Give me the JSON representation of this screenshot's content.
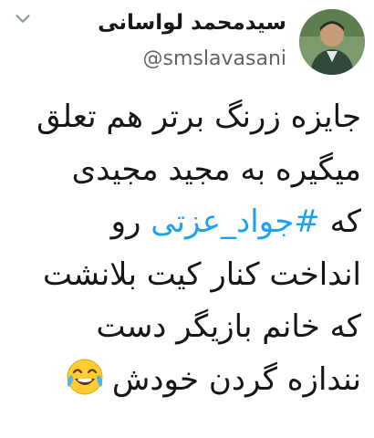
{
  "tweet": {
    "author": {
      "display_name": "سیدمحمد لواسانی",
      "handle": "@smslavasani"
    },
    "body": {
      "line1": "جایزه زرنگ برتر هم تعلق",
      "line2": "میگیره به مجید مجیدی",
      "line3_before": "که ",
      "line3_hashtag": "#جواد_عزتی",
      "line3_after": " رو",
      "line4": "انداخت کنار کیت بلانشت",
      "line5": "که خانم بازیگر دست",
      "line6": "نندازه گردن خودش"
    },
    "icons": {
      "menu": "chevron-down-icon",
      "emoji": "face-with-tears-of-joy-emoji"
    },
    "colors": {
      "hashtag": "#1da1f2",
      "text": "#14171a",
      "handle": "#5b6670"
    }
  }
}
